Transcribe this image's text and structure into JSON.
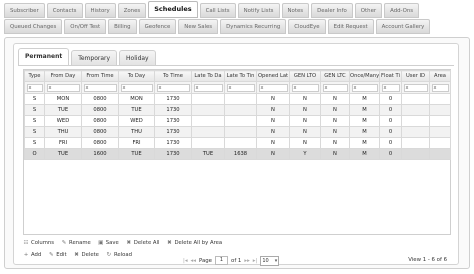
{
  "top_tabs_row1": [
    "Subscriber",
    "Contacts",
    "History",
    "Zones",
    "Schedules",
    "Call Lists",
    "Notify Lists",
    "Notes",
    "Dealer Info",
    "Other",
    "Add-Ons"
  ],
  "top_tabs_row2": [
    "Queued Changes",
    "On/Off Test",
    "Billing",
    "Geofence",
    "New Sales",
    "Dynamics Recurring",
    "CloudEye",
    "Edit Request",
    "Account Gallery"
  ],
  "active_top_tab": "Schedules",
  "sub_tabs": [
    "Permanent",
    "Temporary",
    "Holiday"
  ],
  "active_sub_tab": "Permanent",
  "columns": [
    "Type",
    "From Day",
    "From Time",
    "To Day",
    "To Time",
    "Late To Da",
    "Late To Tin",
    "Opened Lat",
    "GEN LTO",
    "GEN LTC",
    "Once/Many",
    "Float Ti",
    "User ID",
    "Area"
  ],
  "filter_symbol": "x",
  "rows": [
    [
      "S",
      "MON",
      "0800",
      "MON",
      "1730",
      "",
      "",
      "N",
      "N",
      "N",
      "M",
      "0",
      "",
      ""
    ],
    [
      "S",
      "TUE",
      "0800",
      "TUE",
      "1730",
      "",
      "",
      "N",
      "N",
      "N",
      "M",
      "0",
      "",
      ""
    ],
    [
      "S",
      "WED",
      "0800",
      "WED",
      "1730",
      "",
      "",
      "N",
      "N",
      "N",
      "M",
      "0",
      "",
      ""
    ],
    [
      "S",
      "THU",
      "0800",
      "THU",
      "1730",
      "",
      "",
      "N",
      "N",
      "N",
      "M",
      "0",
      "",
      ""
    ],
    [
      "S",
      "FRI",
      "0800",
      "FRI",
      "1730",
      "",
      "",
      "N",
      "N",
      "N",
      "M",
      "0",
      "",
      ""
    ],
    [
      "O",
      "TUE",
      "1600",
      "TUE",
      "1730",
      "TUE",
      "1638",
      "N",
      "Y",
      "N",
      "M",
      "0",
      "",
      ""
    ]
  ],
  "selected_row_index": 5,
  "toolbar1": [
    {
      "icon": "columns-icon",
      "label": "Columns"
    },
    {
      "icon": "rename-icon",
      "label": "Rename"
    },
    {
      "icon": "save-icon",
      "label": "Save"
    },
    {
      "icon": "delete-all-icon",
      "label": "Delete All"
    },
    {
      "icon": "delete-by-area-icon",
      "label": "Delete All by Area"
    }
  ],
  "toolbar2": [
    {
      "icon": "add-icon",
      "label": "Add"
    },
    {
      "icon": "edit-icon",
      "label": "Edit"
    },
    {
      "icon": "delete-icon",
      "label": "Delete"
    },
    {
      "icon": "reload-icon",
      "label": "Reload"
    }
  ],
  "pager": {
    "page_label": "Page",
    "page_value": "1",
    "of_label": "of 1",
    "page_size": "10",
    "view_text": "View 1 - 6 of 6"
  }
}
